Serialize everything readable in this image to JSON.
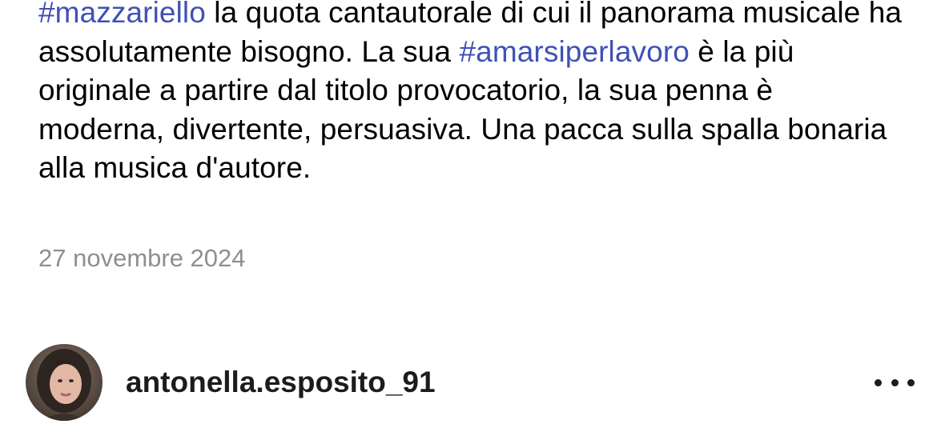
{
  "post": {
    "caption": {
      "hashtag_1": "#mazzariello",
      "text_1": " la quota cantautorale di cui il panorama musicale ha assolutamente bisogno. La sua ",
      "hashtag_2": "#amarsiperlavoro",
      "text_2": " è la più originale a partire dal titolo provocatorio, la sua penna è moderna, divertente, persuasiva. Una pacca sulla spalla bonaria alla musica d'autore."
    },
    "date": "27 novembre 2024"
  },
  "next_post": {
    "username": "antonella.esposito_91",
    "more_icon": "more-horizontal-icon"
  },
  "colors": {
    "hashtag": "#3f51b5",
    "date": "#8e8e93",
    "text": "#000000"
  }
}
